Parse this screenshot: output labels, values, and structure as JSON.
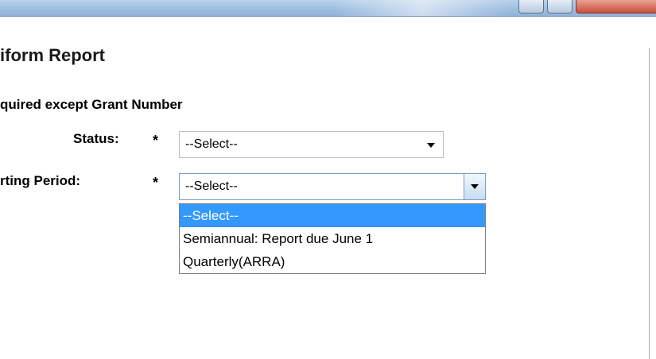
{
  "window": {
    "buttons": [
      "minimize-button",
      "maximize-button",
      "close-button"
    ],
    "colors": {
      "titlebar": "#9fbfe1",
      "close": "#c7503d"
    }
  },
  "page": {
    "title": "iform Report",
    "required_note": "quired except Grant Number"
  },
  "form": {
    "status": {
      "label": "Status:",
      "required_marker": "*",
      "value": "--Select--"
    },
    "reporting_period": {
      "label": "rting Period:",
      "required_marker": "*",
      "value": "--Select--",
      "options": [
        "--Select--",
        "Semiannual: Report due June 1",
        "Quarterly(ARRA)"
      ],
      "highlighted_index": 0
    }
  },
  "colors": {
    "highlight": "#3399ff",
    "select_border": "#bdbdbd",
    "open_select_border": "#7a9cc6"
  }
}
